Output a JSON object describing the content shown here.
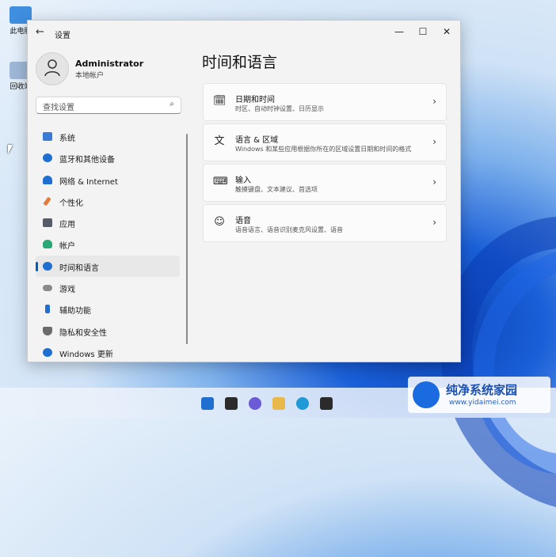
{
  "desktop": {
    "icons": [
      {
        "label": "此电脑"
      },
      {
        "label": "回收站"
      }
    ]
  },
  "window": {
    "title": "设置",
    "back_glyph": "←",
    "minimize_glyph": "—",
    "maximize_glyph": "☐",
    "close_glyph": "✕"
  },
  "user": {
    "name": "Administrator",
    "type": "本地帐户"
  },
  "search": {
    "placeholder": "查找设置",
    "icon": "search-icon"
  },
  "sidebar": {
    "items": [
      {
        "label": "系统",
        "icon": "system-icon",
        "color": "#3a7bd5"
      },
      {
        "label": "蓝牙和其他设备",
        "icon": "bluetooth-icon",
        "color": "#1f6fd1"
      },
      {
        "label": "网络 & Internet",
        "icon": "wifi-icon",
        "color": "#1f6fd1"
      },
      {
        "label": "个性化",
        "icon": "brush-icon",
        "color": "#e07b39"
      },
      {
        "label": "应用",
        "icon": "apps-icon",
        "color": "#555a66"
      },
      {
        "label": "帐户",
        "icon": "person-icon",
        "color": "#2aa876"
      },
      {
        "label": "时间和语言",
        "icon": "globe-clock-icon",
        "color": "#1f6fd1",
        "active": true
      },
      {
        "label": "游戏",
        "icon": "gamepad-icon",
        "color": "#8a8a8a"
      },
      {
        "label": "辅助功能",
        "icon": "accessibility-icon",
        "color": "#1f6fd1"
      },
      {
        "label": "隐私和安全性",
        "icon": "shield-icon",
        "color": "#6b6b6b"
      },
      {
        "label": "Windows 更新",
        "icon": "update-icon",
        "color": "#1f6fd1"
      }
    ]
  },
  "main": {
    "title": "时间和语言",
    "cards": [
      {
        "title": "日期和时间",
        "subtitle": "时区、自动时钟设置、日历显示",
        "icon": "calendar-clock-icon",
        "glyph": "🗓"
      },
      {
        "title": "语言 & 区域",
        "subtitle": "Windows 和某些应用根据你所在的区域设置日期和时间的格式",
        "icon": "language-icon",
        "glyph": "文"
      },
      {
        "title": "输入",
        "subtitle": "触摸键盘、文本建议、首选项",
        "icon": "keyboard-icon",
        "glyph": "⌨"
      },
      {
        "title": "语音",
        "subtitle": "语音语言、语音识别麦克风设置、语音",
        "icon": "speech-icon",
        "glyph": "☺"
      }
    ],
    "chevron": "›"
  },
  "watermark": {
    "title": "纯净系统家园",
    "url": "www.yidaimei.com"
  },
  "colors": {
    "accent": "#005fb8"
  }
}
